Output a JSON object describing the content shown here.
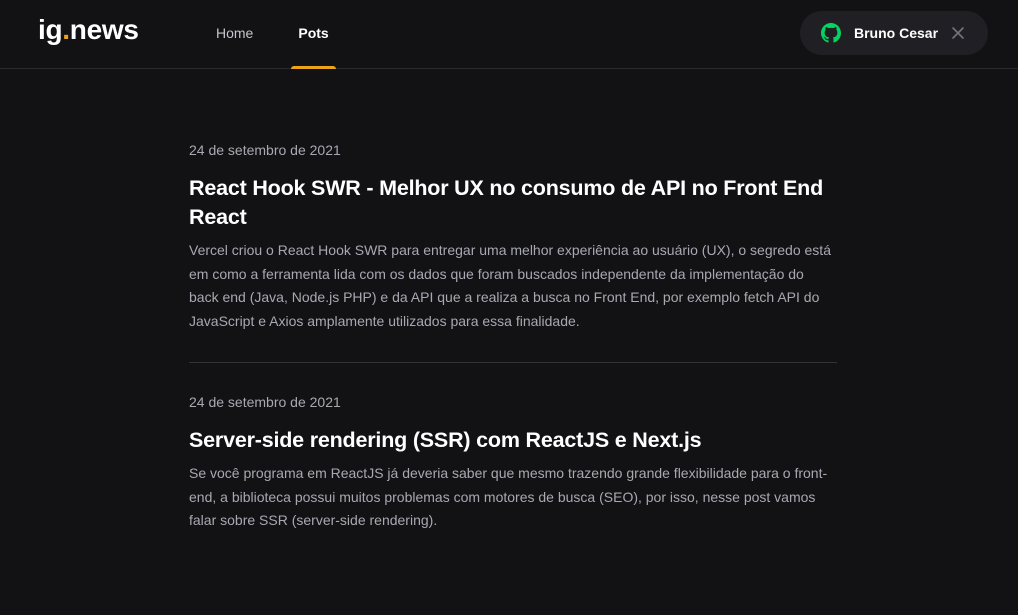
{
  "header": {
    "logo_main": "ig",
    "logo_dot": ".",
    "logo_suffix": "news",
    "nav": [
      {
        "label": "Home",
        "active": false
      },
      {
        "label": "Pots",
        "active": true
      }
    ],
    "user": {
      "name": "Bruno Cesar",
      "icon": "github-icon",
      "icon_color": "#04d361",
      "close_icon": "close-icon"
    }
  },
  "posts": [
    {
      "date": "24 de setembro de 2021",
      "title": "React Hook SWR - Melhor UX no consumo de API no Front End React",
      "excerpt": "Vercel criou o React Hook SWR para entregar uma melhor experiência ao usuário (UX), o segredo está em como a ferramenta lida com os dados que foram buscados independente da implementação do back end (Java, Node.js  PHP) e da API que a realiza a busca no Front End, por exemplo fetch API do JavaScript e Axios amplamente utilizados para essa finalidade."
    },
    {
      "date": "24 de setembro de 2021",
      "title": "Server-side rendering (SSR) com ReactJS e Next.js",
      "excerpt": "Se você programa em ReactJS já deveria saber que mesmo trazendo grande flexibilidade para o front-end, a biblioteca possui muitos problemas com motores de busca (SEO), por isso, nesse post vamos falar sobre SSR (server-side rendering)."
    }
  ],
  "colors": {
    "background": "#121214",
    "accent": "#eba417",
    "github_green": "#04d361"
  }
}
